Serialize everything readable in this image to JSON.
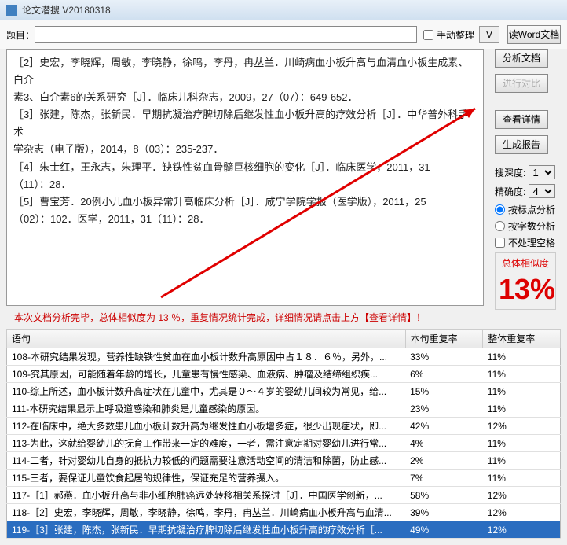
{
  "title": "论文潜搜 V20180318",
  "toprow": {
    "label": "题目：",
    "manual_label": "手动整理",
    "v_label": "V"
  },
  "buttons": {
    "read_word": "读Word文档",
    "analyze": "分析文档",
    "compare": "进行对比",
    "details": "查看详情",
    "report": "生成报告"
  },
  "textbox_lines": [
    "［2］史宏，李晓辉，周敏，李晓静，徐鸣，李丹，冉丛兰．川崎病血小板升高与血清血小板生成素、白介",
    "素3、白介素6的关系研究［J］．临床儿科杂志，2009，27（07）：649-652．",
    "［3］张建，陈杰，张新民．早期抗凝治疗脾切除后继发性血小板升高的疗效分析［J］．中华普外科手术",
    "学杂志（电子版），2014，8（03）：235-237．",
    "［4］朱士红，王永志，朱理平．缺铁性贫血骨髓巨核细胞的变化［J］．临床医学，2011，31",
    "（11）：28．",
    "［5］曹宝芳．20例小儿血小板异常升高临床分析［J］．咸宁学院学报（医学版），2011，25",
    "（02）：102．医学，2011，31（11）：28．"
  ],
  "settings": {
    "depth_label": "搜深度:",
    "depth_val": "1",
    "accuracy_label": "精确度:",
    "accuracy_val": "4",
    "radio1": "按标点分析",
    "radio2": "按字数分析",
    "check1": "不处理空格"
  },
  "similarity": {
    "label": "总体相似度",
    "value": "13%"
  },
  "status": "本次文档分析完毕，总体相似度为 13 ％，重复情况统计完成，详细情况请点击上方【查看详情】！",
  "table": {
    "cols": [
      "语句",
      "本句重复率",
      "整体重复率"
    ],
    "rows": [
      {
        "t": "108-本研究结果发现，营养性缺铁性贫血在血小板计数升高原因中占１８．６％，另外，...",
        "a": "33%",
        "b": "11%"
      },
      {
        "t": "109-究其原因，可能随着年龄的增长，儿童患有慢性感染、血液病、肿瘤及结缔组织疾...",
        "a": "6%",
        "b": "11%"
      },
      {
        "t": "110-综上所述，血小板计数升高症状在儿童中，尤其是０～４岁的婴幼儿间较为常见，给...",
        "a": "15%",
        "b": "11%"
      },
      {
        "t": "111-本研究结果显示上呼吸道感染和肺炎是儿童感染的原因。",
        "a": "23%",
        "b": "11%"
      },
      {
        "t": "112-在临床中，绝大多数患儿血小板计数升高为继发性血小板增多症，很少出现症状，即...",
        "a": "42%",
        "b": "12%"
      },
      {
        "t": "113-为此，这就给婴幼儿的抚育工作带来一定的难度，一者，需注意定期对婴幼儿进行常...",
        "a": "4%",
        "b": "11%"
      },
      {
        "t": "114-二者，针对婴幼儿自身的抵抗力较低的问题需要注意活动空间的清洁和除菌，防止感...",
        "a": "2%",
        "b": "11%"
      },
      {
        "t": "115-三者，要保证儿童饮食起居的规律性，保证充足的营养摄入。",
        "a": "7%",
        "b": "11%"
      },
      {
        "t": "117-［1］郝燕．血小板升高与非小细胞肺癌远处转移相关系探讨［J］．中国医学创新，...",
        "a": "58%",
        "b": "12%"
      },
      {
        "t": "118-［2］史宏，李晓辉，周敏，李晓静，徐鸣，李丹，冉丛兰．川崎病血小板升高与血清...",
        "a": "39%",
        "b": "12%"
      },
      {
        "t": "119-［3］张建，陈杰，张新民．早期抗凝治疗脾切除后继发性血小板升高的疗效分析［...",
        "a": "49%",
        "b": "12%",
        "sel": true
      }
    ]
  }
}
